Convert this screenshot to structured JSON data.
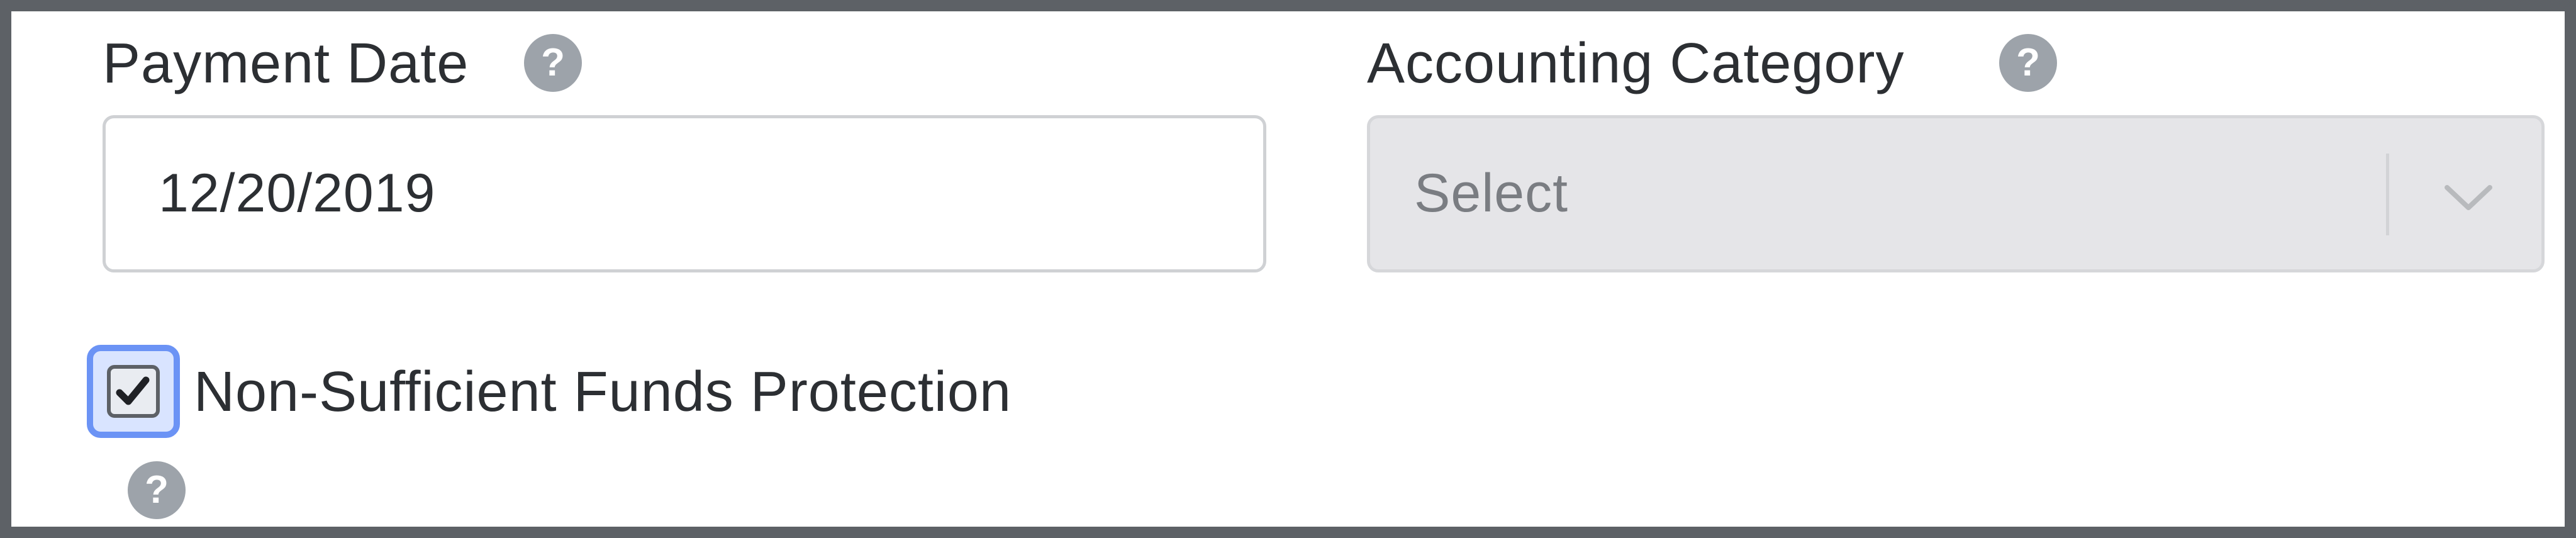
{
  "payment_date": {
    "label": "Payment Date",
    "help": "?",
    "value": "12/20/2019"
  },
  "accounting_category": {
    "label": "Accounting Category",
    "help": "?",
    "selected": "Select",
    "disabled": true
  },
  "nsf_protection": {
    "label": "Non-Sufficient Funds Protection",
    "checked": true,
    "help": "?"
  },
  "icons": [
    "help-icon",
    "chevron-down-icon",
    "checkmark-icon"
  ],
  "colors": {
    "frame_border": "#5d6166",
    "help_icon": "#9da3aa",
    "focus_ring": "#6b93f5",
    "select_disabled_bg": "#e5e5e8",
    "text": "#2c2f33"
  }
}
